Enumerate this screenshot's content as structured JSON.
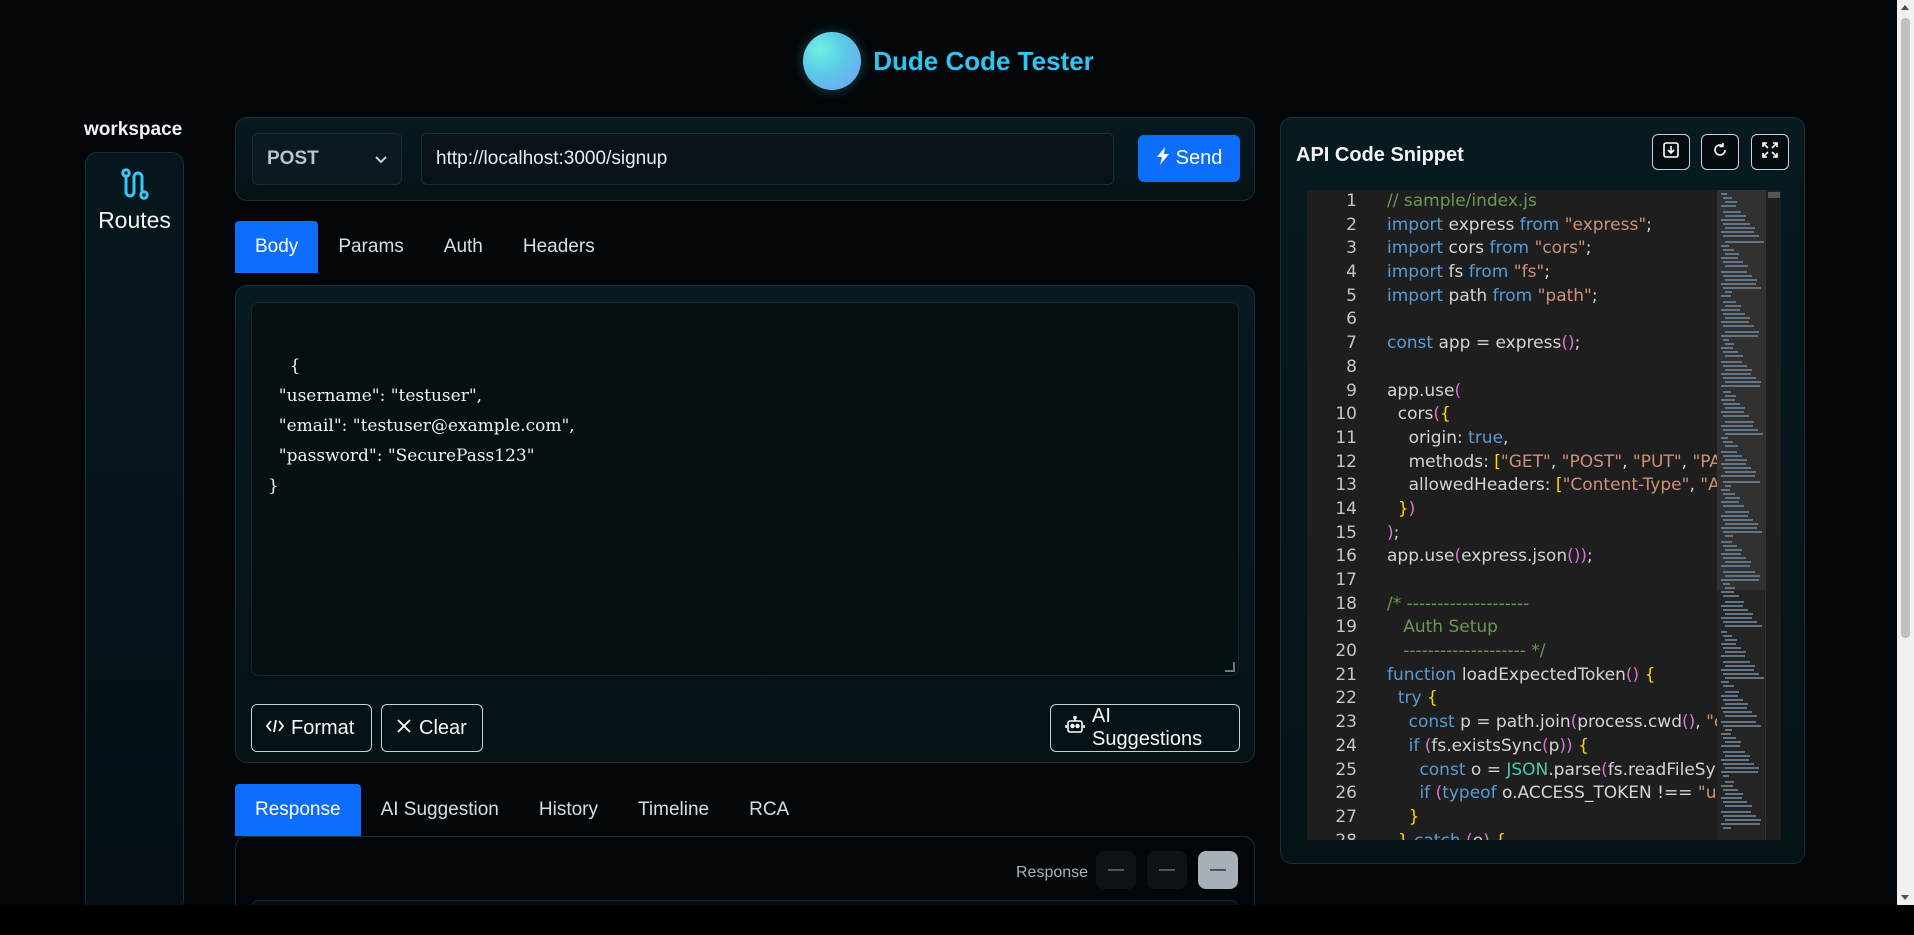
{
  "app": {
    "title": "Dude Code Tester"
  },
  "sidebar": {
    "workspace_label": "workspace",
    "items": [
      {
        "label": "Routes",
        "icon": "route-icon"
      }
    ]
  },
  "request": {
    "method": "POST",
    "url": "http://localhost:3000/signup",
    "send_label": "Send"
  },
  "request_tabs": [
    "Body",
    "Params",
    "Auth",
    "Headers"
  ],
  "active_request_tab": "Body",
  "body": {
    "text": "{\n  \"username\": \"testuser\",\n  \"email\": \"testuser@example.com\",\n  \"password\": \"SecurePass123\"\n}",
    "format_label": "Format",
    "clear_label": "Clear",
    "ai_suggestions_label": "AI Suggestions"
  },
  "response_tabs": [
    "Response",
    "AI Suggestion",
    "History",
    "Timeline",
    "RCA"
  ],
  "active_response_tab": "Response",
  "response": {
    "label": "Response",
    "mode_buttons": [
      "—",
      "—",
      "—"
    ]
  },
  "code_snippet": {
    "title": "API Code Snippet",
    "lines": [
      "// sample/index.js",
      "import express from \"express\";",
      "import cors from \"cors\";",
      "import fs from \"fs\";",
      "import path from \"path\";",
      "",
      "const app = express();",
      "",
      "app.use(",
      "  cors({",
      "    origin: true,",
      "    methods: [\"GET\", \"POST\", \"PUT\", \"PAT",
      "    allowedHeaders: [\"Content-Type\", \"A",
      "  })",
      ");",
      "app.use(express.json());",
      "",
      "/* --------------------",
      "   Auth Setup",
      "   -------------------- */",
      "function loadExpectedToken() {",
      "  try {",
      "    const p = path.join(process.cwd(), \"e",
      "    if (fs.existsSync(p)) {",
      "      const o = JSON.parse(fs.readFileSyr",
      "      if (typeof o.ACCESS_TOKEN !== \"un",
      "    }",
      "  } catch (e) {"
    ]
  },
  "colors": {
    "accent": "#0d6efd",
    "title": "#2ec5f0",
    "background": "#020608"
  }
}
